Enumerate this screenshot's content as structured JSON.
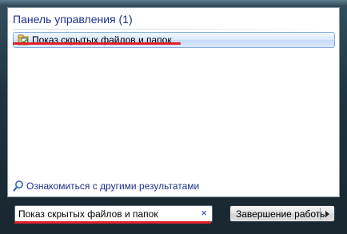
{
  "results": {
    "group_title": "Панель управления (1)",
    "items": [
      {
        "label": "Показ скрытых файлов и папок",
        "icon": "folder-options-icon"
      }
    ],
    "see_more_label": "Ознакомиться с другими результатами",
    "see_more_icon": "search-icon"
  },
  "search": {
    "value": "Показ скрытых файлов и папок",
    "clear_glyph": "×"
  },
  "shutdown": {
    "label": "Завершение работы",
    "arrow_icon": "triangle-right-icon"
  },
  "colors": {
    "link_text": "#1e3287",
    "highlight_border": "#84acdd",
    "annotation_underline": "#e3202a"
  }
}
